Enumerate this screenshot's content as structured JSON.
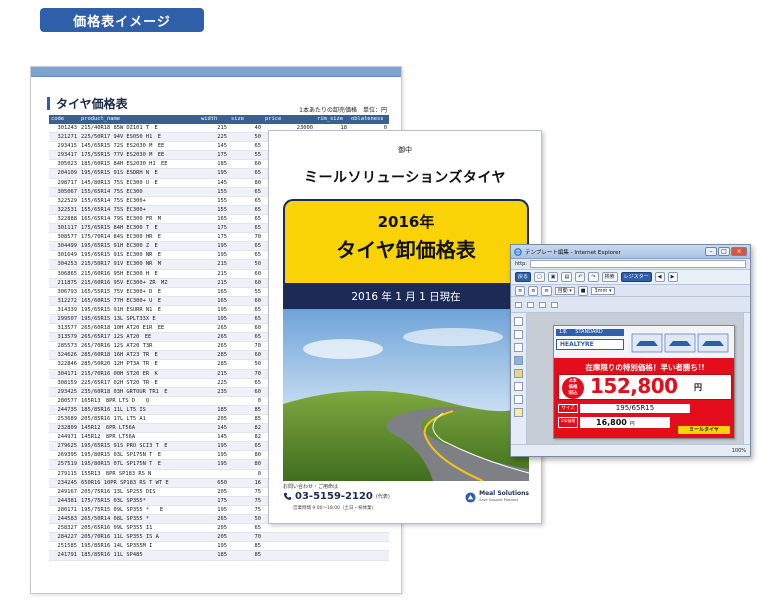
{
  "header": {
    "tab_label": "価格表イメージ"
  },
  "sheet": {
    "title": "タイヤ価格表",
    "note": "1本あたりの卸売価格　単位：円",
    "columns": [
      "code",
      "product_name",
      "width",
      "size",
      "price",
      "rim_size",
      "oblateness"
    ],
    "rows": [
      [
        "301243",
        "215/40R18 85W DZ101 T　E",
        "215",
        "40",
        "23000",
        "18",
        "0"
      ],
      [
        "321271",
        "225/50R17 94V ES050 H1　E",
        "225",
        "50",
        "",
        "",
        ""
      ],
      [
        "293415",
        "145/65R15 72S ES2030 M　EE",
        "145",
        "65",
        "",
        "",
        ""
      ],
      [
        "293417",
        "175/55R15 77V ES2030 M　EE",
        "175",
        "55",
        "",
        "",
        ""
      ],
      [
        "305023",
        "185/60R15 84H ES2030 H1　EE",
        "185",
        "60",
        "",
        "",
        ""
      ],
      [
        "204109",
        "195/65R15 91S ESDRH N　E",
        "195",
        "65",
        "",
        "",
        ""
      ],
      [
        "298717",
        "145/80R13 75S EC300 U　E",
        "145",
        "80",
        "",
        "",
        ""
      ],
      [
        "305067",
        "155/65R14 75S EC300",
        "155",
        "65",
        "",
        "",
        ""
      ],
      [
        "322529",
        "155/65R14 75S EC300+",
        "155",
        "65",
        "",
        "",
        ""
      ],
      [
        "322531",
        "155/65R14 75S EC300+",
        "155",
        "65",
        "",
        "",
        ""
      ],
      [
        "322888",
        "165/65R14 79S EC300 FR　M",
        "165",
        "65",
        "",
        "",
        ""
      ],
      [
        "301117",
        "175/65R15 84H EC300 T　E",
        "175",
        "65",
        "",
        "",
        ""
      ],
      [
        "308577",
        "175/70R14 84S EC300 HR　E",
        "175",
        "70",
        "",
        "",
        ""
      ],
      [
        "304499",
        "195/65R15 91H EC300 Z　E",
        "195",
        "65",
        "",
        "",
        ""
      ],
      [
        "301649",
        "195/65R15 91S EC300 NR　E",
        "195",
        "65",
        "",
        "",
        ""
      ],
      [
        "304253",
        "215/50R17 91V EC300 NR　M",
        "215",
        "50",
        "",
        "",
        ""
      ],
      [
        "306865",
        "215/60R16 95H EC300 H　E",
        "215",
        "60",
        "",
        "",
        ""
      ],
      [
        "211875",
        "215/60R16 95V EC300+ ZR　MZ",
        "215",
        "60",
        "",
        "",
        ""
      ],
      [
        "306793",
        "165/55R15 75V EC300+ D　E",
        "165",
        "55",
        "",
        "",
        ""
      ],
      [
        "312272",
        "165/60R15 77H EC300+ U　E",
        "165",
        "60",
        "",
        "",
        ""
      ],
      [
        "314339",
        "195/65R15 91H ESURR N1　E",
        "195",
        "65",
        "",
        "",
        ""
      ],
      [
        "299507",
        "195/65R15 13L SPLT33X E",
        "195",
        "65",
        "",
        "",
        ""
      ],
      [
        "313577",
        "265/60R18 10H AT20 E1R　EE",
        "265",
        "60",
        "",
        "",
        ""
      ],
      [
        "313579",
        "265/65R17 12S AT20　EE",
        "265",
        "65",
        "",
        "",
        ""
      ],
      [
        "285573",
        "265/70R16 12S AT20 T3R",
        "265",
        "70",
        "",
        "",
        ""
      ],
      [
        "324626",
        "285/60R18 16H AT23 TR　E",
        "285",
        "60",
        "",
        "",
        ""
      ],
      [
        "322846",
        "285/50R20 12H PT3A TR　E",
        "285",
        "50",
        "",
        "",
        ""
      ],
      [
        "304171",
        "215/70R16 00H ST20 ER　K",
        "215",
        "70",
        "",
        "",
        ""
      ],
      [
        "308159",
        "225/65R17 02H ST20 TR　E",
        "225",
        "65",
        "",
        "",
        ""
      ],
      [
        "293425",
        "235/60R18 03H GRTOUR TR1　E",
        "235",
        "60",
        "",
        "",
        ""
      ],
      [
        "280577",
        "165R13　8PR LTS D　　Q",
        "",
        "0",
        "",
        "",
        ""
      ],
      [
        "244735",
        "185/85R16 11L LT5 IS",
        "185",
        "85",
        "",
        "",
        ""
      ],
      [
        "253689",
        "205/85R16 17L LT5 A1",
        "205",
        "85",
        "",
        "",
        ""
      ],
      [
        "232809",
        "145R12　6PR LT56A",
        "145",
        "82",
        "",
        "",
        ""
      ],
      [
        "244971",
        "145R12　8PR LT56A",
        "145",
        "82",
        "",
        "",
        ""
      ],
      [
        "279625",
        "195/65R15 91S PRO SCI3 T　E",
        "195",
        "65",
        "",
        "",
        ""
      ],
      [
        "269395",
        "195/80R15 03L SP175N T　E",
        "195",
        "80",
        "",
        "",
        ""
      ],
      [
        "257519",
        "195/80R15 07L SP175N T　E",
        "195",
        "80",
        "",
        "",
        ""
      ],
      [
        "279115",
        "155R13　8PR SP183 RS N",
        "",
        "0",
        "",
        "",
        ""
      ],
      [
        "234245",
        "650R16 10PR SP183 RS T WT E",
        "650",
        "16",
        "",
        "",
        ""
      ],
      [
        "249167",
        "205/75R16 13L SP255 DIS",
        "205",
        "75",
        "",
        "",
        ""
      ],
      [
        "244381",
        "175/75R15 03L SP355*",
        "175",
        "75",
        "",
        "",
        ""
      ],
      [
        "280171",
        "195/75R15 09L SP355 *　　E",
        "195",
        "75",
        "",
        "",
        ""
      ],
      [
        "244583",
        "265/50R14 08L SP355 *",
        "265",
        "50",
        "",
        "",
        ""
      ],
      [
        "258327",
        "205/65R16 09L SP355 I1",
        "205",
        "65",
        "",
        "",
        ""
      ],
      [
        "284227",
        "205/70R16 11L SP355 IS A",
        "205",
        "70",
        "",
        "",
        ""
      ],
      [
        "251585",
        "195/85R16 14L SP355M I",
        "195",
        "85",
        "",
        "",
        ""
      ],
      [
        "241791",
        "185/85R16 11L SP485",
        "185",
        "85",
        "",
        "",
        ""
      ]
    ]
  },
  "cover": {
    "small_label": "御中",
    "company_title": "ミールソリューションズタイヤ",
    "year": "2016年",
    "main_title": "タイヤ卸価格表",
    "date_band": "2016 年 1 月 1 日現在",
    "contact_label": "お問い合わせ・ご用命は",
    "phone": "03-5159-2120",
    "phone_suffix": "(代表)",
    "hours": "営業時間 9:00～18:00（土日・祝休業）",
    "logo_name": "Meal Solutions",
    "logo_sub": "Save Support Partners"
  },
  "ie": {
    "title": "テンプレート編集 - Internet Explorer",
    "address_label": "http:",
    "toolbar": {
      "back": "戻る",
      "search": "検索",
      "register": "レジスター"
    },
    "font_select": "自動",
    "size_select": "3mm",
    "zoom": "100%",
    "pop": {
      "band_left": "1本",
      "band_right": "STANDARD",
      "brand": "HEALTYRE",
      "headline": "在庫限りの特別価格！早い者勝ち!!",
      "badge_line1": "4本",
      "badge_line2": "価格",
      "badge_line3": "税込",
      "price": "152,800",
      "price_unit": "円",
      "size_label": "サイズ",
      "size_value": "195/65R15",
      "tag2_label": "1本価格",
      "price2": "16,800",
      "price2_unit": "円",
      "footer": "ミールタイヤ"
    }
  }
}
